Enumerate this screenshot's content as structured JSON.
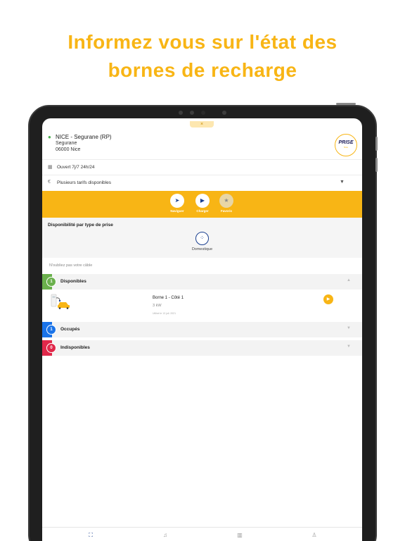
{
  "headline": {
    "line1": "Informez vous sur l'état des",
    "line2": "bornes de recharge"
  },
  "colors": {
    "accent": "#f8b515",
    "available": "#6ab04c",
    "occupied": "#1a73e8",
    "unavailable": "#e0284a",
    "navy": "#1a3f8f"
  },
  "station": {
    "name": "NICE - Segurane (RP)",
    "street": "Segurane",
    "city": "06000 Nice",
    "brand_line1": "PRISE",
    "brand_line2": "Nice"
  },
  "info": {
    "hours": "Ouvert 7j/7 24h/24",
    "tariffs": "Plusieurs tarifs disponibles"
  },
  "actions": {
    "navigate": "Naviguer",
    "charge": "Charger",
    "favorite": "Favoris"
  },
  "availability": {
    "title": "Disponibilité par type de prise",
    "plug_label": "Domestique",
    "cable_note": "N'oubliez pas votre câble"
  },
  "status": {
    "available": {
      "count": "1",
      "label": "Disponibles"
    },
    "occupied": {
      "count": "1",
      "label": "Occupés"
    },
    "unavailable": {
      "count": "0",
      "label": "Indisponibles"
    }
  },
  "borne": {
    "name": "Borne 1 - Côté 1",
    "power": "3 kW",
    "used": "Utilisé le 13 juil. 2021"
  },
  "tabbar": {
    "icons": [
      "map-icon",
      "bell-icon",
      "chart-icon",
      "user-icon"
    ]
  }
}
